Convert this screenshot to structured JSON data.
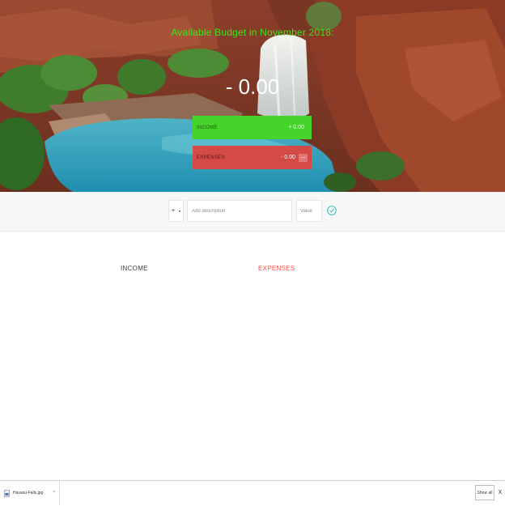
{
  "header": {
    "title": "Available Budget in November 2018:",
    "budget_value": "- 0.00",
    "background_image": "Havasu Falls landscape photo"
  },
  "summary": {
    "income": {
      "label": "INCOME",
      "value": "+ 0.00"
    },
    "expenses": {
      "label": "EXPENSES",
      "value": "- 0.00",
      "percentage": "---"
    }
  },
  "add_bar": {
    "type_value": "+",
    "type_arrow": "▾",
    "description_placeholder": "Add description",
    "value_placeholder": "Value",
    "submit_icon": "checkmark-circle-icon"
  },
  "lists": {
    "income_title": "INCOME",
    "expenses_title": "EXPENSES"
  },
  "download_bar": {
    "file_name": "Havasu-Falls.jpg",
    "caret": "^",
    "show_all_label": "Show all",
    "close_label": "X"
  },
  "colors": {
    "budget_title": "#3ee61c",
    "income": "#45d52a",
    "expenses": "#d44a47",
    "expenses_title": "#ff5049",
    "checkmark": "#28b9b5"
  }
}
